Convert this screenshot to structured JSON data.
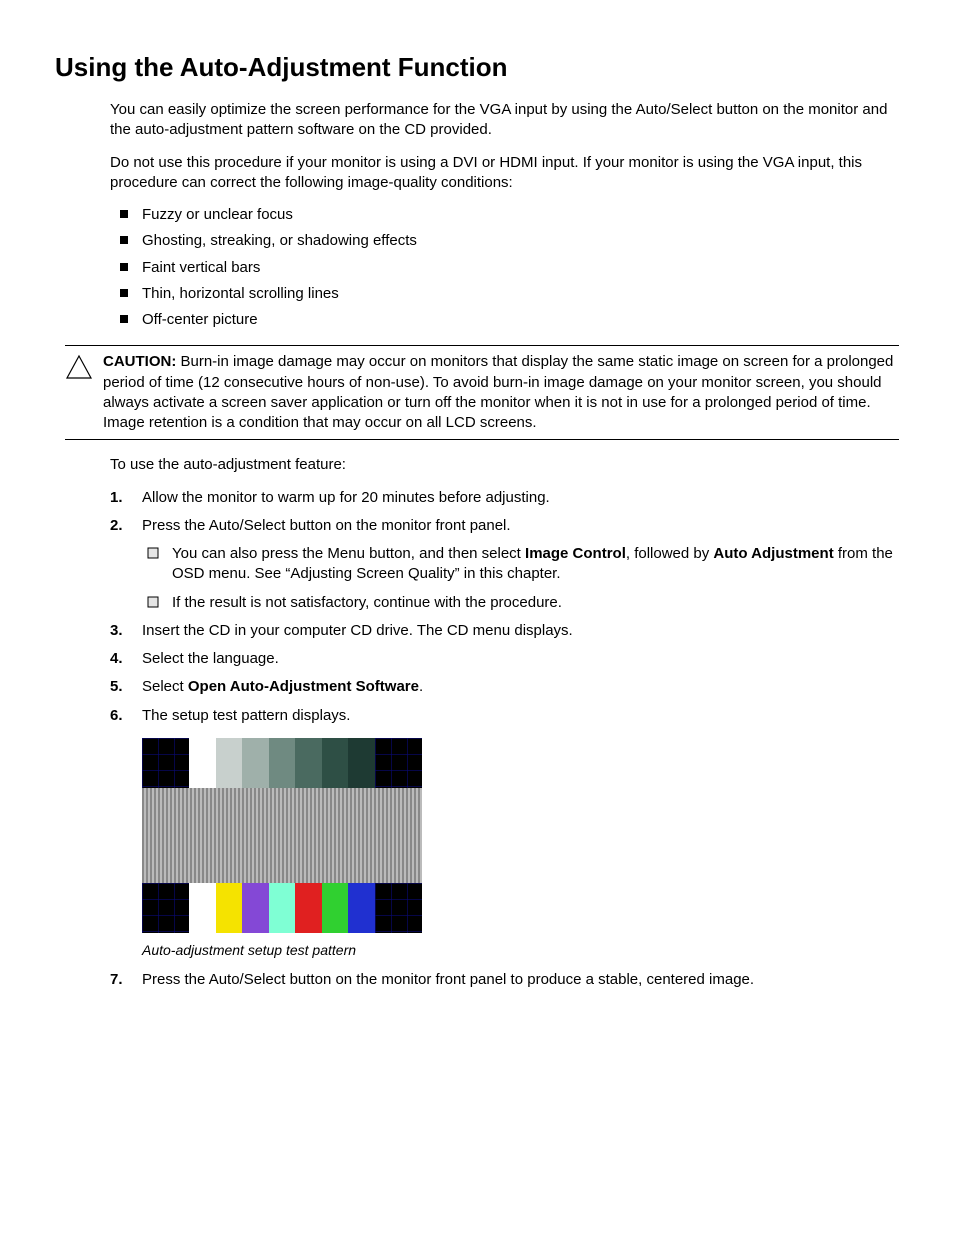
{
  "heading": "Using the Auto-Adjustment Function",
  "intro1": "You can easily optimize the screen performance for the VGA input by using the Auto/Select button on the monitor and the auto-adjustment pattern software on the CD provided.",
  "intro2": "Do not use this procedure if your monitor is using a DVI or HDMI input. If your monitor is using the VGA input, this procedure can correct the following image-quality conditions:",
  "bullets": [
    "Fuzzy or unclear focus",
    "Ghosting, streaking, or shadowing effects",
    "Faint vertical bars",
    "Thin, horizontal scrolling lines",
    "Off-center picture"
  ],
  "caution_label": "CAUTION:",
  "caution_text": " Burn-in image damage may occur on monitors that display the same static image on screen for a prolonged period of time (12 consecutive hours of non-use). To avoid burn-in image damage on your monitor screen, you should always activate a screen saver application or turn off the monitor when it is not in use for a prolonged period of time. Image retention is a condition that may occur on all LCD screens.",
  "lead_in": "To use the auto-adjustment feature:",
  "steps": {
    "s1": {
      "num": "1.",
      "text": "Allow the monitor to warm up for 20 minutes before adjusting."
    },
    "s2": {
      "num": "2.",
      "text": "Press the Auto/Select button on the monitor front panel."
    },
    "s2a_pre": "You can also press the Menu button, and then select ",
    "s2a_b1": "Image Control",
    "s2a_mid": ", followed by ",
    "s2a_b2": "Auto Adjustment",
    "s2a_post": " from the OSD menu. See “Adjusting Screen Quality” in this chapter.",
    "s2b": "If the result is not satisfactory, continue with the procedure.",
    "s3": {
      "num": "3.",
      "text": "Insert the CD in your computer CD drive. The CD menu displays."
    },
    "s4": {
      "num": "4.",
      "text": "Select the language."
    },
    "s5": {
      "num": "5.",
      "pre": "Select ",
      "bold": "Open Auto-Adjustment Software",
      "post": "."
    },
    "s6": {
      "num": "6.",
      "text": "The setup test pattern displays."
    },
    "s7": {
      "num": "7.",
      "text": "Press the Auto/Select button on the monitor front panel to produce a stable, centered image."
    }
  },
  "caption": "Auto-adjustment setup test pattern",
  "pattern": {
    "top_gradient": [
      "#ffffff",
      "#c8d0cd",
      "#9fb0aa",
      "#6f8a81",
      "#4a6a60",
      "#2e4f45",
      "#1e3a33"
    ],
    "bottom_colors": [
      "#ffffff",
      "#f5e300",
      "#8448d6",
      "#7fffd4",
      "#e02020",
      "#30d030",
      "#2030d0"
    ]
  }
}
